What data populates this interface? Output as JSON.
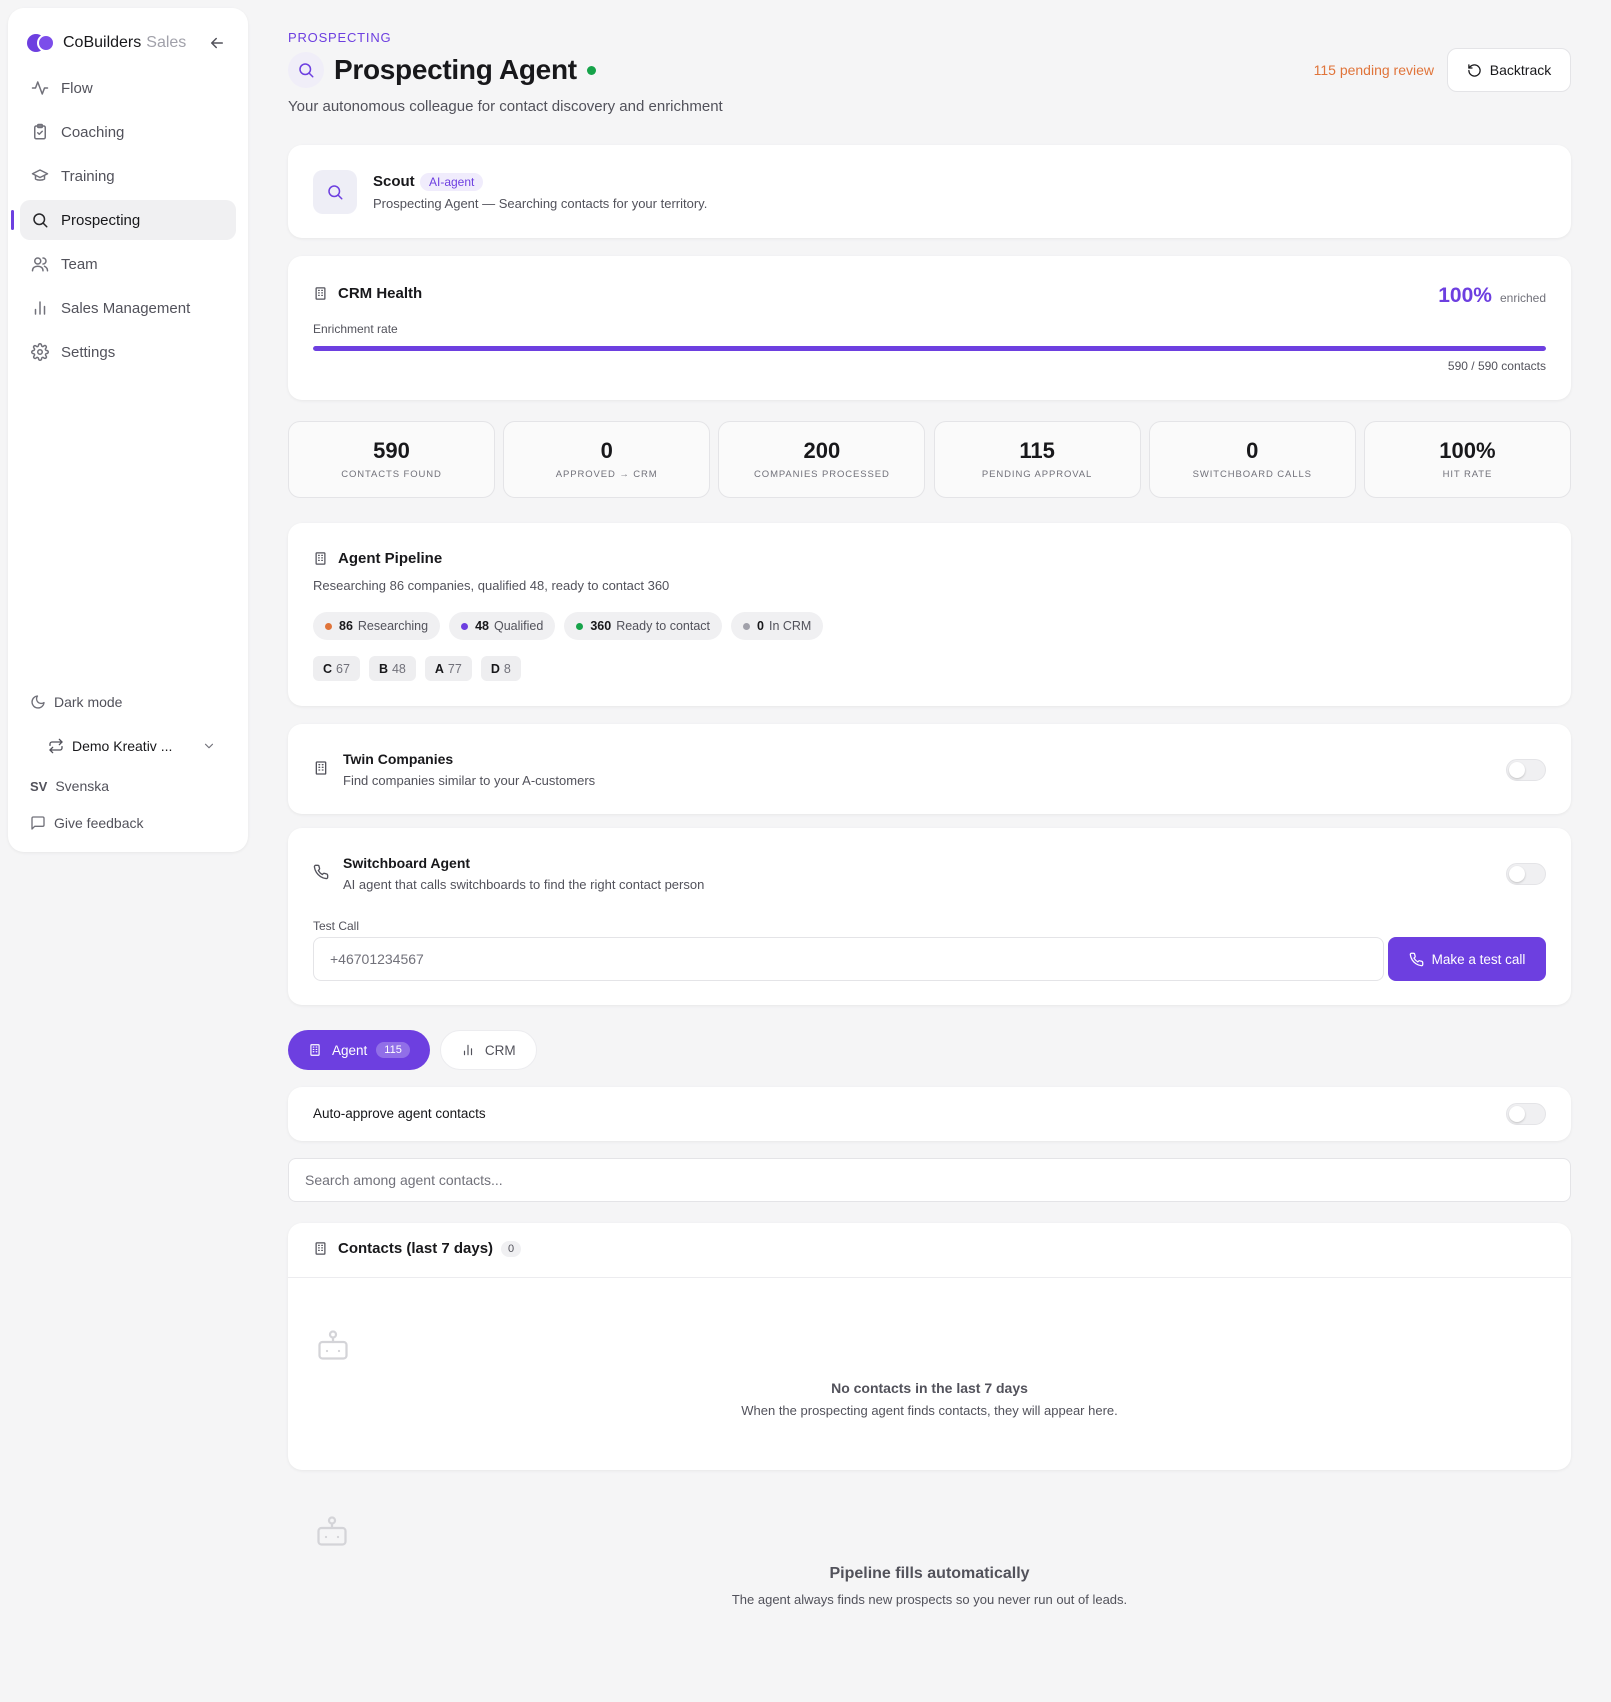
{
  "brand": {
    "name": "CoBuilders",
    "suffix": "Sales"
  },
  "sidebar": {
    "items": [
      {
        "label": "Flow",
        "icon": "activity-icon"
      },
      {
        "label": "Coaching",
        "icon": "clipboard-icon"
      },
      {
        "label": "Training",
        "icon": "graduation-cap-icon"
      },
      {
        "label": "Prospecting",
        "icon": "search-icon",
        "active": true
      },
      {
        "label": "Team",
        "icon": "users-icon"
      },
      {
        "label": "Sales Management",
        "icon": "bar-chart-icon"
      },
      {
        "label": "Settings",
        "icon": "gear-icon"
      }
    ],
    "dark_mode": "Dark mode",
    "workspace": "Demo Kreativ ...",
    "language_code": "SV",
    "language": "Svenska",
    "feedback": "Give feedback"
  },
  "header": {
    "eyebrow": "PROSPECTING",
    "title": "Prospecting Agent",
    "subtitle": "Your autonomous colleague for contact discovery and enrichment",
    "pending_review": "115 pending review",
    "backtrack_label": "Backtrack",
    "status_color": "#16a34a"
  },
  "scout": {
    "name": "Scout",
    "badge": "AI-agent",
    "description": "Prospecting Agent — Searching contacts for your territory."
  },
  "crm_health": {
    "title": "CRM Health",
    "percent": "100%",
    "percent_suffix": "enriched",
    "rate_label": "Enrichment rate",
    "progress_fraction": 1.0,
    "count": "590 / 590 contacts"
  },
  "stats": [
    {
      "value": "590",
      "label": "Contacts found"
    },
    {
      "value": "0",
      "label": "Approved → CRM"
    },
    {
      "value": "200",
      "label": "Companies processed"
    },
    {
      "value": "115",
      "label": "Pending approval"
    },
    {
      "value": "0",
      "label": "Switchboard calls"
    },
    {
      "value": "100%",
      "label": "Hit rate"
    }
  ],
  "pipeline": {
    "title": "Agent Pipeline",
    "summary": "Researching 86 companies, qualified 48, ready to contact 360",
    "stages": [
      {
        "count": "86",
        "label": "Researching",
        "color": "#e0743a"
      },
      {
        "count": "48",
        "label": "Qualified",
        "color": "#6d3fe0"
      },
      {
        "count": "360",
        "label": "Ready to contact",
        "color": "#16a34a"
      },
      {
        "count": "0",
        "label": "In CRM",
        "color": "#a1a1aa"
      }
    ],
    "grades": [
      {
        "grade": "C",
        "count": "67"
      },
      {
        "grade": "B",
        "count": "48"
      },
      {
        "grade": "A",
        "count": "77"
      },
      {
        "grade": "D",
        "count": "8"
      }
    ]
  },
  "twin": {
    "title": "Twin Companies",
    "description": "Find companies similar to your A-customers"
  },
  "switchboard": {
    "title": "Switchboard Agent",
    "description": "AI agent that calls switchboards to find the right contact person",
    "test_label": "Test Call",
    "phone_placeholder": "+46701234567",
    "call_button": "Make a test call"
  },
  "tabs": [
    {
      "label": "Agent",
      "count": "115",
      "active": true
    },
    {
      "label": "CRM"
    }
  ],
  "auto_approve_label": "Auto-approve agent contacts",
  "search_placeholder": "Search among agent contacts...",
  "contacts": {
    "title": "Contacts (last 7 days)",
    "count": "0",
    "empty_title": "No contacts in the last 7 days",
    "empty_desc": "When the prospecting agent finds contacts, they will appear here."
  },
  "footer": {
    "title": "Pipeline fills automatically",
    "desc": "The agent always finds new prospects so you never run out of leads."
  },
  "accent_color": "#6d3fe0"
}
